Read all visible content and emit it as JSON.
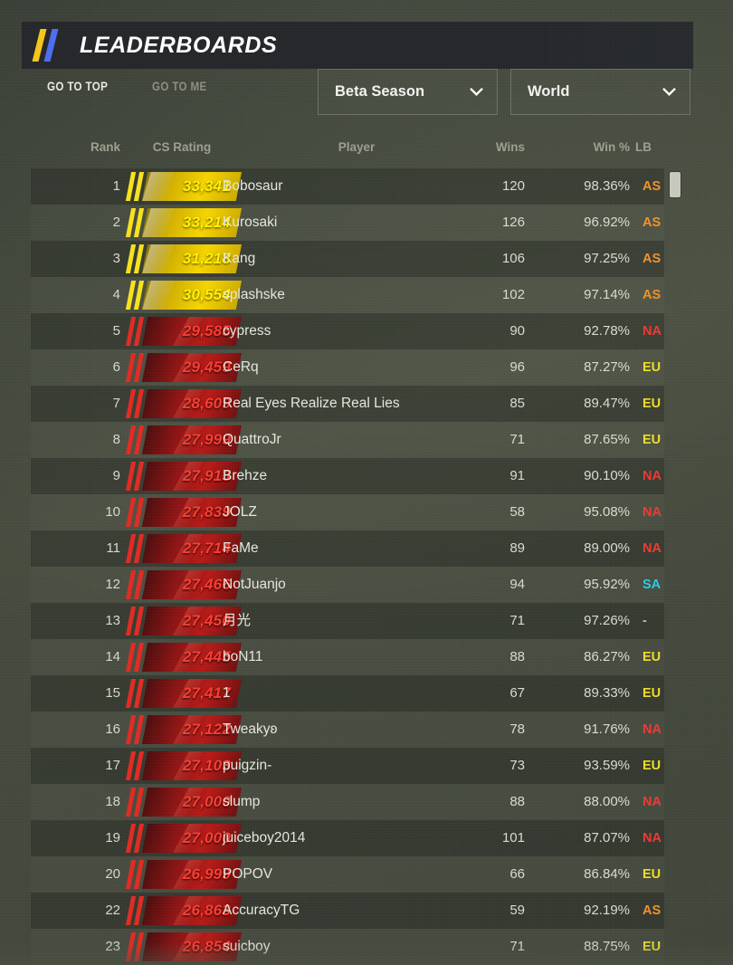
{
  "header": {
    "title": "LEADERBOARDS",
    "logo_colors": {
      "bar1": "#f5c518",
      "bar2": "#4a6ef0"
    }
  },
  "nav": {
    "go_to_top": "GO TO TOP",
    "go_to_me": "GO TO ME"
  },
  "filters": {
    "season": {
      "label": "Beta Season",
      "icon": "chevron-down-icon"
    },
    "region": {
      "label": "World",
      "icon": "chevron-down-icon"
    }
  },
  "columns": {
    "rank": "Rank",
    "rating": "CS Rating",
    "player": "Player",
    "wins": "Wins",
    "win_pct": "Win %",
    "lb": "LB"
  },
  "region_colors": {
    "AS": "#f0922a",
    "EU": "#eddc2a",
    "NA": "#ec3a34",
    "SA": "#2bc8ea",
    "-": "#b9bcb0"
  },
  "rows": [
    {
      "rank": "1",
      "rating": "33,341",
      "tier": "gold",
      "player": "Bobosaur",
      "wins": "120",
      "win_pct": "98.36%",
      "lb": "AS"
    },
    {
      "rank": "2",
      "rating": "33,214",
      "tier": "gold",
      "player": "Kurosaki",
      "wins": "126",
      "win_pct": "96.92%",
      "lb": "AS"
    },
    {
      "rank": "3",
      "rating": "31,218",
      "tier": "gold",
      "player": "Kang",
      "wins": "106",
      "win_pct": "97.25%",
      "lb": "AS"
    },
    {
      "rank": "4",
      "rating": "30,554",
      "tier": "gold",
      "player": "splashske",
      "wins": "102",
      "win_pct": "97.14%",
      "lb": "AS"
    },
    {
      "rank": "5",
      "rating": "29,585",
      "tier": "red",
      "player": "cypress",
      "wins": "90",
      "win_pct": "92.78%",
      "lb": "NA"
    },
    {
      "rank": "6",
      "rating": "29,459",
      "tier": "red",
      "player": "CeRq",
      "wins": "96",
      "win_pct": "87.27%",
      "lb": "EU"
    },
    {
      "rank": "7",
      "rating": "28,609",
      "tier": "red",
      "player": "Real Eyes Realize Real Lies",
      "wins": "85",
      "win_pct": "89.47%",
      "lb": "EU"
    },
    {
      "rank": "8",
      "rating": "27,999",
      "tier": "red",
      "player": "QuattroJr",
      "wins": "71",
      "win_pct": "87.65%",
      "lb": "EU"
    },
    {
      "rank": "9",
      "rating": "27,913",
      "tier": "red",
      "player": "Brehze",
      "wins": "91",
      "win_pct": "90.10%",
      "lb": "NA"
    },
    {
      "rank": "10",
      "rating": "27,839",
      "tier": "red",
      "player": "JOLZ",
      "wins": "58",
      "win_pct": "95.08%",
      "lb": "NA"
    },
    {
      "rank": "11",
      "rating": "27,714",
      "tier": "red",
      "player": "FaMe",
      "wins": "89",
      "win_pct": "89.00%",
      "lb": "NA"
    },
    {
      "rank": "12",
      "rating": "27,466",
      "tier": "red",
      "player": "NotJuanjo",
      "wins": "94",
      "win_pct": "95.92%",
      "lb": "SA"
    },
    {
      "rank": "13",
      "rating": "27,450",
      "tier": "red",
      "player": "月光",
      "wins": "71",
      "win_pct": "97.26%",
      "lb": "-"
    },
    {
      "rank": "14",
      "rating": "27,445",
      "tier": "red",
      "player": "boN11",
      "wins": "88",
      "win_pct": "86.27%",
      "lb": "EU"
    },
    {
      "rank": "15",
      "rating": "27,417",
      "tier": "red",
      "player": "1",
      "wins": "67",
      "win_pct": "89.33%",
      "lb": "EU"
    },
    {
      "rank": "16",
      "rating": "27,122",
      "tier": "red",
      "player": "Tweakyʚ",
      "wins": "78",
      "win_pct": "91.76%",
      "lb": "NA"
    },
    {
      "rank": "17",
      "rating": "27,103",
      "tier": "red",
      "player": "puigzin-",
      "wins": "73",
      "win_pct": "93.59%",
      "lb": "EU"
    },
    {
      "rank": "18",
      "rating": "27,000",
      "tier": "red",
      "player": "slump",
      "wins": "88",
      "win_pct": "88.00%",
      "lb": "NA"
    },
    {
      "rank": "19",
      "rating": "27,000",
      "tier": "red",
      "player": "juiceboy2014",
      "wins": "101",
      "win_pct": "87.07%",
      "lb": "NA"
    },
    {
      "rank": "20",
      "rating": "26,999",
      "tier": "red",
      "player": "POPOV",
      "wins": "66",
      "win_pct": "86.84%",
      "lb": "EU"
    },
    {
      "rank": "22",
      "rating": "26,863",
      "tier": "red",
      "player": "AccuracyTG",
      "wins": "59",
      "win_pct": "92.19%",
      "lb": "AS"
    },
    {
      "rank": "23",
      "rating": "26,854",
      "tier": "red",
      "player": "suicboy",
      "wins": "71",
      "win_pct": "88.75%",
      "lb": "EU"
    }
  ]
}
